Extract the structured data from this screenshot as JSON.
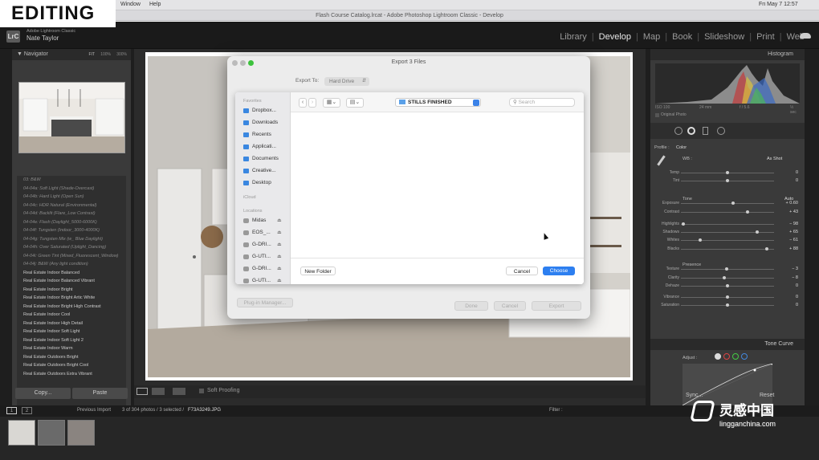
{
  "overlay_title": "EDITING",
  "mac_menu": {
    "window": "Window",
    "help": "Help",
    "clock": "Fri May 7  12:57"
  },
  "window_title": "Flash Course Catalog.lrcat - Adobe Photoshop Lightroom Classic - Develop",
  "identity": {
    "logo": "LrC",
    "product": "Adobe Lightroom Classic",
    "user": "Nate Taylor"
  },
  "modules": [
    "Library",
    "Develop",
    "Map",
    "Book",
    "Slideshow",
    "Print",
    "Web"
  ],
  "active_module": "Develop",
  "navigator": {
    "title": "Navigator",
    "zoom": [
      "FIT",
      "100%",
      "300%"
    ]
  },
  "presets": [
    {
      "label": "03: B&W",
      "dim": true
    },
    {
      "label": "04-04a: Soft Light (Shade-Overcast)",
      "dim": true
    },
    {
      "label": "04-04b: Hard Light (Open Sun)",
      "dim": true
    },
    {
      "label": "04-04c: HDR Natural (Environmental)",
      "dim": true
    },
    {
      "label": "04-04d: Backlit (Flare_Low Contrast)",
      "dim": true
    },
    {
      "label": "04-04e: Flash (Daylight_5000-6000K)",
      "dim": true
    },
    {
      "label": "04-04f: Tungsten (Indoor_3000-4000K)",
      "dim": true
    },
    {
      "label": "04-04g: Tungsten Mix (w_ Blue Daylight)",
      "dim": true
    },
    {
      "label": "04-04h: Over Saturated (Uplight_Dancing)",
      "dim": true
    },
    {
      "label": "04-04i: Green Tint (Mixed_Fluorescent_Window)",
      "dim": true
    },
    {
      "label": "04-04j: B&W (Any light condition)",
      "dim": true
    },
    {
      "label": "Real Estate Indoor Balanced",
      "dim": false
    },
    {
      "label": "Real Estate Indoor Balanced Vibrant",
      "dim": false
    },
    {
      "label": "Real Estate Indoor Bright",
      "dim": false
    },
    {
      "label": "Real Estate Indoor Bright Artic White",
      "dim": false
    },
    {
      "label": "Real Estate Indoor Bright High Contrast",
      "dim": false
    },
    {
      "label": "Real Estate Indoor Cool",
      "dim": false
    },
    {
      "label": "Real Estate Indoor High Detail",
      "dim": false
    },
    {
      "label": "Real Estate Indoor Soft Light",
      "dim": false
    },
    {
      "label": "Real Estate Indoor Soft Light 2",
      "dim": false
    },
    {
      "label": "Real Estate Indoor Warm",
      "dim": false
    },
    {
      "label": "Real Estate Outdoors Bright",
      "dim": false
    },
    {
      "label": "Real Estate Outdoors Bright Cool",
      "dim": false
    },
    {
      "label": "Real Estate Outdoors Extra Vibrant",
      "dim": false
    }
  ],
  "left_buttons": {
    "copy": "Copy...",
    "paste": "Paste"
  },
  "toolbar": {
    "soft_proofing": "Soft Proofing"
  },
  "dialog": {
    "title": "Export 3 Files",
    "export_to_label": "Export To:",
    "export_to_value": "Hard Drive",
    "plugin_manager": "Plug-in Manager...",
    "done": "Done",
    "cancel": "Cancel",
    "export": "Export"
  },
  "file_sheet": {
    "favorites_head": "Favorites",
    "favorites": [
      "Dropbox...",
      "Downloads",
      "Recents",
      "Applicati...",
      "Documents",
      "Creative...",
      "Desktop"
    ],
    "icloud_head": "iCloud",
    "locations_head": "Locations",
    "locations": [
      "Midas",
      "EOS_...",
      "G-DRI...",
      "G-UTI...",
      "G-DRI...",
      "G-UTI..."
    ],
    "folder": "STILLS FINISHED",
    "search_placeholder": "Search",
    "new_folder": "New Folder",
    "cancel": "Cancel",
    "choose": "Choose"
  },
  "right_panel": {
    "histogram_title": "Histogram",
    "meta": [
      "ISO 100",
      "24 mm",
      "f / 5.6",
      "⅓ sec"
    ],
    "original_photo": "Original Photo",
    "profile": "Profile :",
    "color": "Color",
    "wb_label": "WB :",
    "wb_value": "As Shot",
    "tone": "Tone",
    "auto": "Auto",
    "presence": "Presence",
    "tone_curve": "Tone Curve",
    "adjust": "Adjust :",
    "sync": "Sync...",
    "reset": "Reset"
  },
  "sliders": [
    {
      "label": "Temp",
      "value": "0",
      "pos": 0.5
    },
    {
      "label": "Tint",
      "value": "0",
      "pos": 0.5
    },
    {
      "label": "Exposure",
      "value": "+ 0.60",
      "pos": 0.56
    },
    {
      "label": "Contrast",
      "value": "+ 43",
      "pos": 0.72
    },
    {
      "label": "Highlights",
      "value": "− 98",
      "pos": 0.01
    },
    {
      "label": "Shadows",
      "value": "+ 65",
      "pos": 0.83
    },
    {
      "label": "Whites",
      "value": "− 61",
      "pos": 0.2
    },
    {
      "label": "Blacks",
      "value": "+ 88",
      "pos": 0.94
    },
    {
      "label": "Texture",
      "value": "− 3",
      "pos": 0.49
    },
    {
      "label": "Clarity",
      "value": "− 8",
      "pos": 0.46
    },
    {
      "label": "Dehaze",
      "value": "0",
      "pos": 0.5
    },
    {
      "label": "Vibrance",
      "value": "0",
      "pos": 0.5
    },
    {
      "label": "Saturation",
      "value": "0",
      "pos": 0.5
    }
  ],
  "filmstrip": {
    "pages": [
      "1",
      "2"
    ],
    "previous_import": "Previous Import",
    "count": "3 of 304 photos / 3 selected /",
    "filename": "F73A3249.JPG",
    "filter": "Filter :",
    "filters_off": "Filters Off"
  },
  "watermark": {
    "brand": "灵感中国",
    "url": "lingganchina.com"
  }
}
